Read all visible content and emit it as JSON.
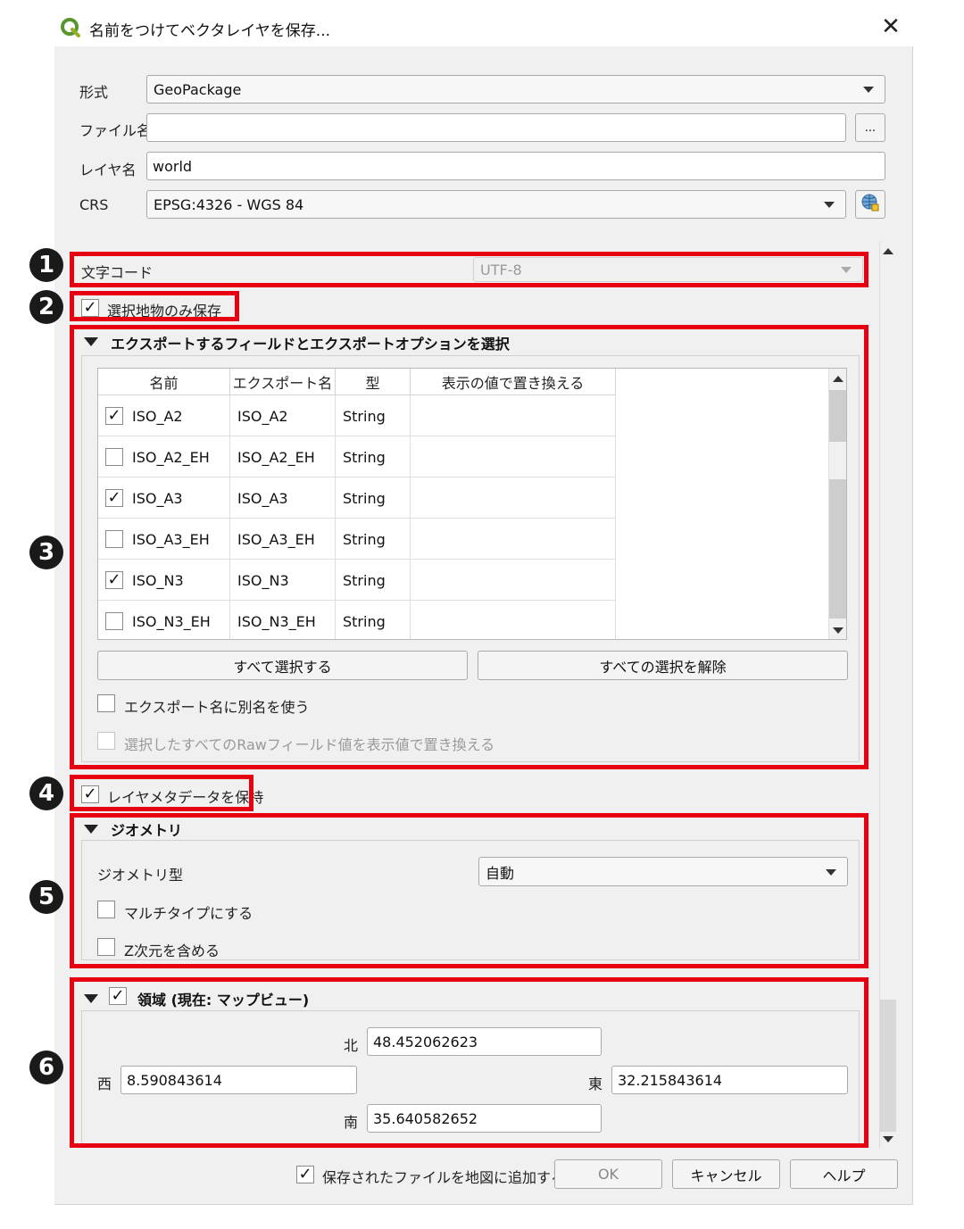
{
  "dialog": {
    "title": "名前をつけてベクタレイヤを保存...",
    "close_glyph": "✕"
  },
  "form": {
    "format_label": "形式",
    "format_value": "GeoPackage",
    "filename_label": "ファイル名",
    "filename_value": "",
    "browse_label": "...",
    "layer_label": "レイヤ名",
    "layer_value": "world",
    "crs_label": "CRS",
    "crs_value": "EPSG:4326 - WGS 84"
  },
  "encoding": {
    "label": "文字コード",
    "value": "UTF-8"
  },
  "save_selected": {
    "label": "選択地物のみ保存",
    "checked": true
  },
  "fields_section": {
    "title": "エクスポートするフィールドとエクスポートオプションを選択",
    "columns": [
      "名前",
      "エクスポート名",
      "型",
      "表示の値で置き換える"
    ],
    "rows": [
      {
        "checked": true,
        "name": "ISO_A2",
        "export_name": "ISO_A2",
        "type": "String"
      },
      {
        "checked": false,
        "name": "ISO_A2_EH",
        "export_name": "ISO_A2_EH",
        "type": "String"
      },
      {
        "checked": true,
        "name": "ISO_A3",
        "export_name": "ISO_A3",
        "type": "String"
      },
      {
        "checked": false,
        "name": "ISO_A3_EH",
        "export_name": "ISO_A3_EH",
        "type": "String"
      },
      {
        "checked": true,
        "name": "ISO_N3",
        "export_name": "ISO_N3",
        "type": "String"
      },
      {
        "checked": false,
        "name": "ISO_N3_EH",
        "export_name": "ISO_N3_EH",
        "type": "String"
      }
    ],
    "select_all": "すべて選択する",
    "deselect_all": "すべての選択を解除",
    "alias_label": "エクスポート名に別名を使う",
    "replace_raw_label": "選択したすべてのRawフィールド値を表示値で置き換える"
  },
  "metadata": {
    "label": "レイヤメタデータを保持",
    "checked": true
  },
  "geometry": {
    "title": "ジオメトリ",
    "type_label": "ジオメトリ型",
    "type_value": "自動",
    "multi_label": "マルチタイプにする",
    "z_label": "Z次元を含める"
  },
  "extent": {
    "title": "領域 (現在: マップビュー)",
    "checked": true,
    "north_label": "北",
    "north": "48.452062623",
    "west_label": "西",
    "west": "8.590843614",
    "east_label": "東",
    "east": "32.215843614",
    "south_label": "南",
    "south": "35.640582652"
  },
  "footer": {
    "add_to_map_label": "保存されたファイルを地図に追加する",
    "add_to_map_checked": true,
    "ok": "OK",
    "cancel": "キャンセル",
    "help": "ヘルプ"
  },
  "annotations": {
    "n1": "1",
    "n2": "2",
    "n3": "3",
    "n4": "4",
    "n5": "5",
    "n6": "6",
    "highlight_color": "#e60012"
  }
}
